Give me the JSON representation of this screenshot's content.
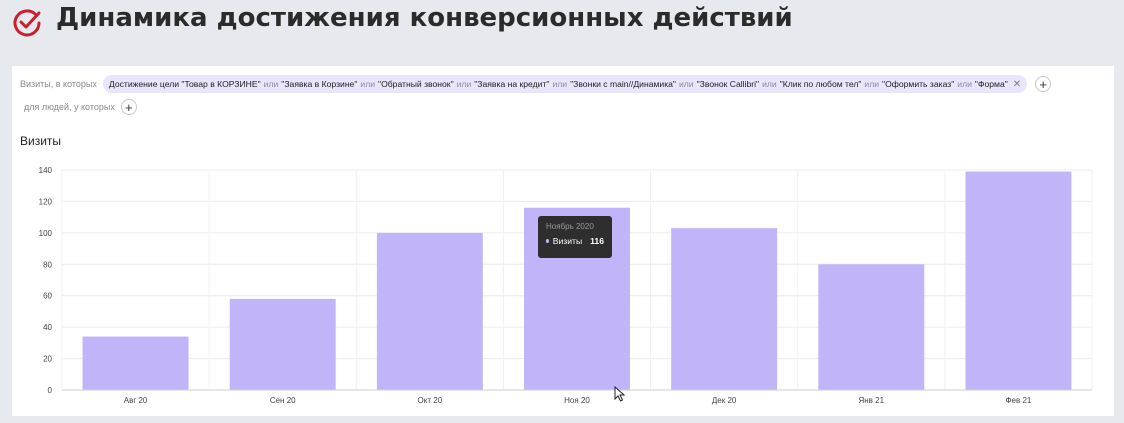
{
  "header": {
    "title": "Динамика достижения конверсионных действий",
    "icon": "check-circle-icon",
    "icon_color": "#cc1f2d"
  },
  "filters": {
    "prefix": "Визиты, в которых",
    "chip_segments": [
      "Достижение цели \"Товар в КОРЗИНЕ\"",
      "\"Заявка в Корзине\"",
      "\"Обратный звонок\"",
      "\"Заявка на кредит\"",
      "\"Звонки с main//Динамика\"",
      "\"Звонок Callibri\"",
      "\"Клик по любом тел\"",
      "\"Оформить заказ\"",
      "\"Форма\""
    ],
    "or_word": "или",
    "close_icon": "close-icon",
    "add_icon": "plus-icon",
    "second_prefix": "для людей, у которых",
    "chip_color": "#e9e5fb"
  },
  "chart_data": {
    "type": "bar",
    "title": "Визиты",
    "categories": [
      "Авг 20",
      "Сен 20",
      "Окт 20",
      "Ноя 20",
      "Дек 20",
      "Янв 21",
      "Фев 21"
    ],
    "series": [
      {
        "name": "Визиты",
        "values": [
          34,
          58,
          100,
          116,
          103,
          80,
          139
        ],
        "color": "#c2b4f8"
      }
    ],
    "ylim": [
      0,
      140
    ],
    "yticks": [
      0,
      20,
      40,
      60,
      80,
      100,
      120,
      140
    ],
    "grid": true,
    "tooltip": {
      "title": "Ноябрь 2020",
      "series": "Визиты",
      "value": "116"
    }
  }
}
